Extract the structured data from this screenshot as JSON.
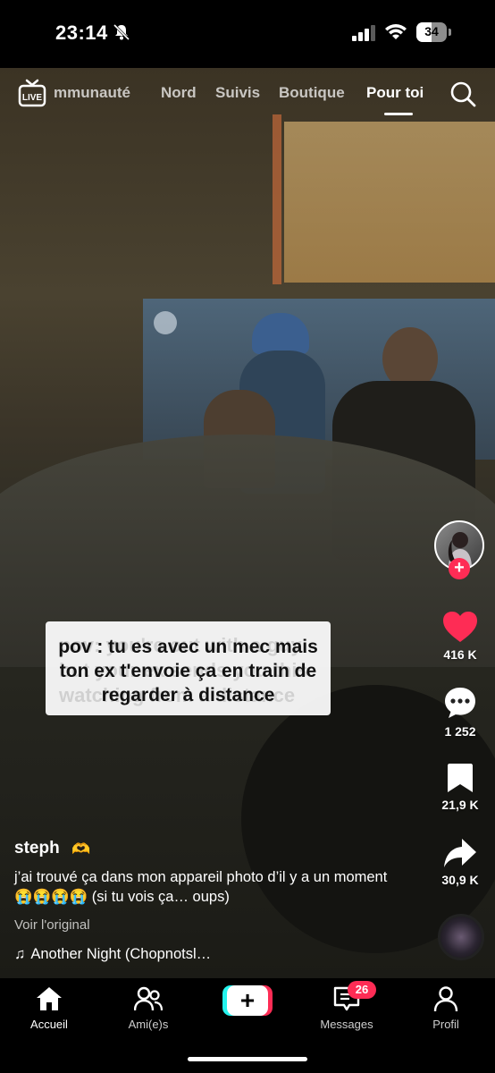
{
  "status_bar": {
    "time": "23:14",
    "battery": "34"
  },
  "top_nav": {
    "live_label": "LIVE",
    "tabs": [
      {
        "label": "mmunauté"
      },
      {
        "label": "Nord"
      },
      {
        "label": "Suivis"
      },
      {
        "label": "Boutique"
      },
      {
        "label": "Pour toi"
      }
    ],
    "active_tab": "Pour toi"
  },
  "video": {
    "caption_overlay": "pov : tu es avec un mec mais ton ex t'envoie ça en train de regarder à distance",
    "caption_underlay": "pov: you're out with a guy but your ex sends you this watching from a distance"
  },
  "actions": {
    "likes": "416 K",
    "comments": "1 252",
    "saves": "21,9 K",
    "shares": "30,9 K"
  },
  "post": {
    "username": "steph",
    "username_emoji": "🫶",
    "description": "j’ai trouvé ça dans mon appareil photo d’il y a un moment 😭😭😭😭 (si tu vois ça… oups)",
    "see_original": "Voir l'original",
    "music_note": "♫",
    "music": "Another Night (Chopnotsl…"
  },
  "tab_bar": {
    "home": "Accueil",
    "friends": "Ami(e)s",
    "create": "+",
    "inbox": "Messages",
    "inbox_badge": "26",
    "profile": "Profil"
  },
  "colors": {
    "accent_red": "#fe2c55",
    "accent_cyan": "#25f4ee",
    "background": "#000000"
  }
}
